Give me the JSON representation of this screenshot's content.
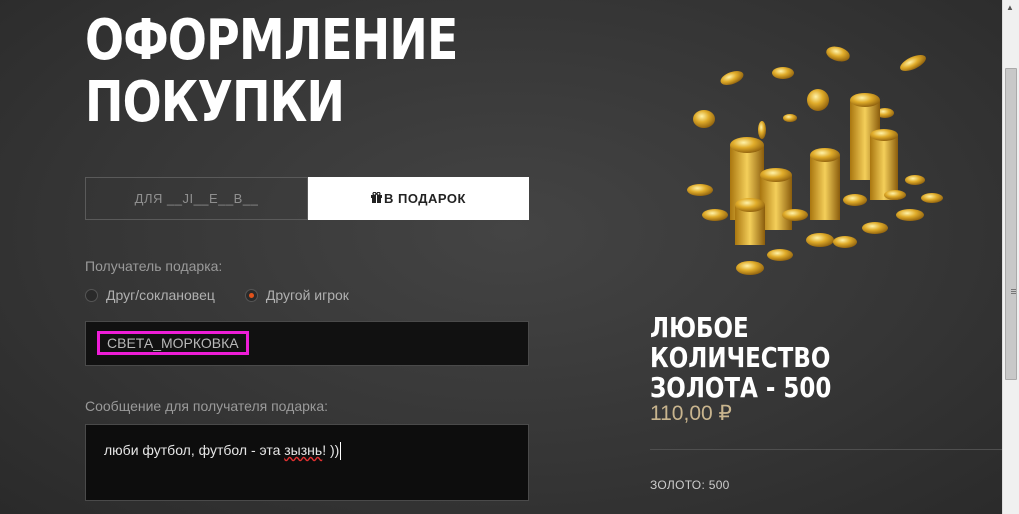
{
  "page": {
    "title": "ОФОРМЛЕНИЕ ПОКУПКИ"
  },
  "tabs": [
    {
      "label": "ДЛЯ __JI__E__B__",
      "active": false
    },
    {
      "label": "В ПОДАРОК",
      "active": true,
      "icon": "gift-icon"
    }
  ],
  "recipient": {
    "label": "Получатель подарка:",
    "options": [
      {
        "label": "Друг/соклановец",
        "checked": false
      },
      {
        "label": "Другой игрок",
        "checked": true
      }
    ],
    "value": "СВЕТА_МОРКОВКА",
    "highlight_color": "#ee1dd7"
  },
  "message": {
    "label": "Сообщение для получателя подарка:",
    "value_before": "люби футбол, футбол - эта ",
    "value_typo": "зызнь",
    "value_after": "! ))"
  },
  "product": {
    "title": "ЛЮБОЕ КОЛИЧЕСТВО ЗОЛОТА - 500",
    "price": "110,00 ₽",
    "gold_amount": "ЗОЛОТО: 500",
    "image": "gold-coins-pile"
  },
  "colors": {
    "accent": "#e2521b",
    "price": "#c9b58e",
    "gold": "#d9a520"
  }
}
